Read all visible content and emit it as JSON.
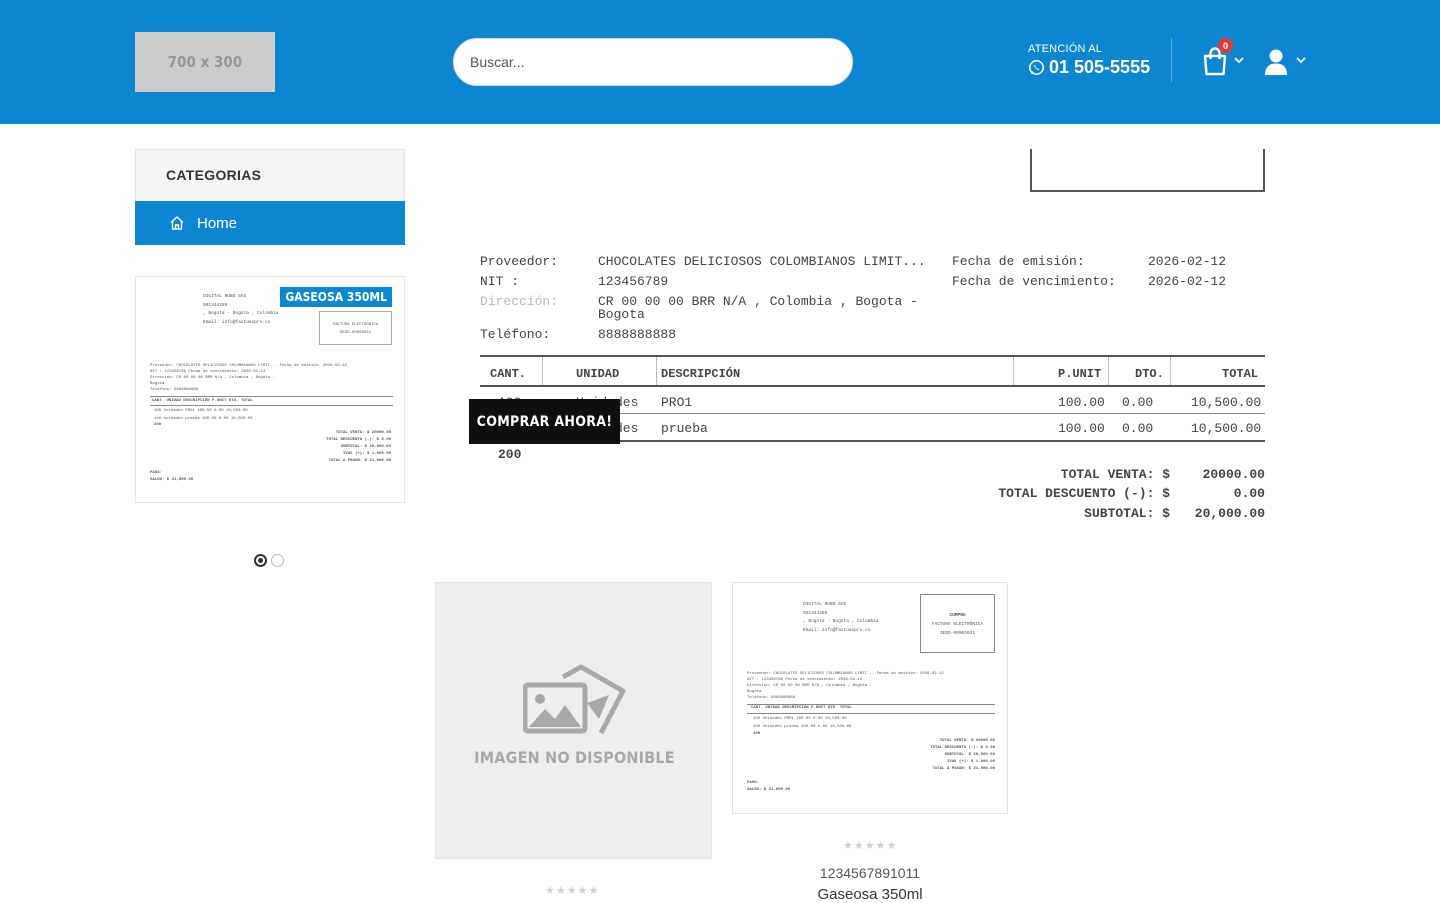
{
  "header": {
    "logo_text": "700 x 300",
    "search_placeholder": "Buscar...",
    "contact_label": "ATENCIÓN AL",
    "contact_phone": "01 505-5555",
    "cart_count": "0"
  },
  "sidebar": {
    "categories_title": "CATEGORIAS",
    "items": [
      {
        "label": "Home"
      }
    ],
    "featured_tag": "GASEOSA 350ML",
    "mini_invoice": {
      "company": "DIGITAL HUBO SAS",
      "company_nit": "901344289",
      "company_city": ", Bogota - Bogota , Colombia",
      "company_email": "Email: info@factuaspro.co",
      "doc_box_line1": "FACTURA ELECTRÓNICA",
      "doc_box_line2": "SEDD-00003031",
      "lines": [
        "Proveedor:  CHOCOLATES DELICIOSOS COLOMBIANOS LIMIT...  Fecha de emisión:     2026-02-12",
        "NIT :       123456789                                  Fecha de vencimiento: 2026-02-12",
        "Dirección:  CR 00 00 00 BRR N/A , Colombia , Bogota -",
        "            Bogota",
        "Teléfono:   8888888888"
      ],
      "table_header": "CANT.   UNIDAD   DESCRIPCIÓN                       P.UNIT  DTO.   TOTAL",
      "rows": [
        "100     Unidades  PRO1                            100.00  0.00  10,500.00",
        "100     Unidades  prueba                          100.00  0.00  10,500.00"
      ],
      "qty_total": "200",
      "totals": [
        "TOTAL VENTA: $   20000.00",
        "TOTAL DESCUENTO (-): $      0.00",
        "SUBTOTAL: $  20,000.00",
        "IVA5 (+): $   1,000.00",
        "TOTAL A PAGAR: $  21,000.00"
      ],
      "footer_1": "PAGO:",
      "footer_2": "SALDO:  $ 21,000.00"
    }
  },
  "invoice": {
    "proveedor_label": "Proveedor:",
    "proveedor_value": "CHOCOLATES DELICIOSOS COLOMBIANOS LIMIT...",
    "nit_label": "NIT :",
    "nit_value": "123456789",
    "direccion_label": "Dirección:",
    "direccion_value_1": "CR 00 00 00 BRR N/A , Colombia , Bogota -",
    "direccion_value_2": "Bogota",
    "telefono_label": "Teléfono:",
    "telefono_value": "8888888888",
    "fecha_emision_label": "Fecha de emisión:",
    "fecha_emision_value": "2026-02-12",
    "fecha_venc_label": "Fecha de vencimiento:",
    "fecha_venc_value": "2026-02-12",
    "columns": [
      "CANT.",
      "UNIDAD",
      "DESCRIPCIÓN",
      "P.UNIT",
      "DTO.",
      "TOTAL"
    ],
    "rows": [
      {
        "cant": "100",
        "unidad": "Unidades",
        "desc": "PRO1",
        "punit": "100.00",
        "dto": "0.00",
        "total": "10,500.00"
      },
      {
        "cant": "100",
        "unidad": "Unidades",
        "desc": "prueba",
        "punit": "100.00",
        "dto": "0.00",
        "total": "10,500.00"
      }
    ],
    "qty_total": "200",
    "total_venta_label": "TOTAL VENTA: $",
    "total_venta_value": "20000.00",
    "total_desc_label": "TOTAL DESCUENTO (-): $",
    "total_desc_value": "0.00",
    "subtotal_label": "SUBTOTAL: $",
    "subtotal_value": "20,000.00"
  },
  "buy_now_label": "COMPRAR AHORA!",
  "products": [
    {
      "image_text": "IMAGEN NO DISPONIBLE",
      "rating": 0
    },
    {
      "code": "1234567891011",
      "name": "Gaseosa 350ml",
      "rating": 0,
      "box_title": "COMPRA",
      "box_line1": "FACTURA ELECTRÓNICA",
      "box_line2": "SEDD-00003031"
    }
  ],
  "colors": {
    "brand": "#0a87d0",
    "badge": "#e53935",
    "button": "#0f0f0f"
  },
  "icons": [
    "whatsapp-icon",
    "cart-icon",
    "user-icon",
    "chevron-down-icon",
    "home-icon",
    "no-image-icon",
    "star-icon"
  ]
}
